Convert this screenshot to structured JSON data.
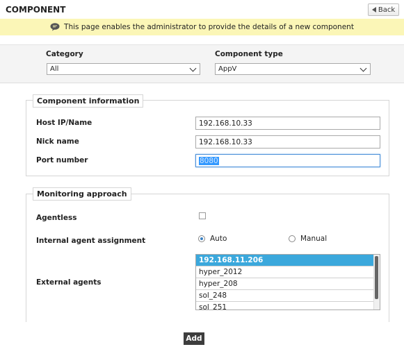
{
  "header": {
    "title": "COMPONENT",
    "back_label": "Back",
    "info_text": "This page enables the administrator to provide the details of a new component"
  },
  "filters": {
    "category_label": "Category",
    "category_value": "All",
    "component_type_label": "Component type",
    "component_type_value": "AppV"
  },
  "component_info": {
    "legend": "Component information",
    "host_label": "Host IP/Name",
    "host_value": "192.168.10.33",
    "nick_label": "Nick name",
    "nick_value": "192.168.10.33",
    "port_label": "Port number",
    "port_value": "8080"
  },
  "monitoring": {
    "legend": "Monitoring approach",
    "agentless_label": "Agentless",
    "agentless_checked": false,
    "internal_label": "Internal agent assignment",
    "auto_label": "Auto",
    "manual_label": "Manual",
    "selected_assignment": "Auto",
    "external_label": "External agents",
    "external_agents": [
      "192.168.11.206",
      "hyper_2012",
      "hyper_208",
      "sol_248",
      "sol_251"
    ],
    "selected_agent": "192.168.11.206"
  },
  "actions": {
    "add_label": "Add"
  },
  "colors": {
    "info_bar": "#fbf6b7",
    "selected_option": "#3ba8dc",
    "add_button": "#3d3d3d"
  }
}
